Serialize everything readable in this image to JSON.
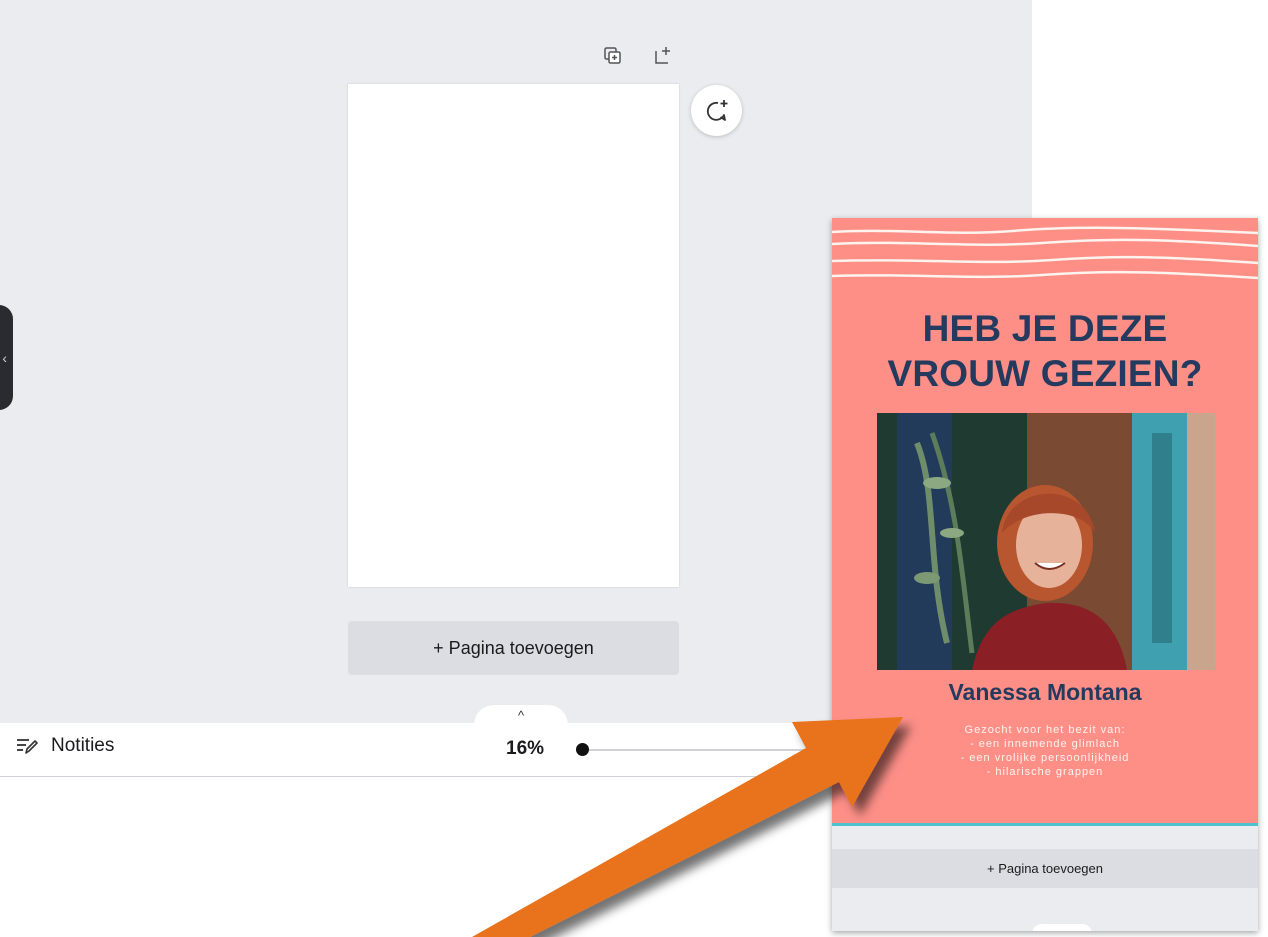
{
  "editor": {
    "add_page_label": "+ Pagina toevoegen",
    "side_handle_icon": "chevron-left-icon",
    "page_tools": [
      "duplicate-page-icon",
      "add-page-icon"
    ],
    "comment_icon": "add-comment-icon"
  },
  "footer": {
    "tab_icon": "^",
    "notes_label": "Notities",
    "zoom_label": "16%",
    "zoom_level_percent": 16
  },
  "preview": {
    "headline_line1": "HEB JE DEZE",
    "headline_line2": "VROUW GEZIEN?",
    "name": "Vanessa Montana",
    "details": [
      "Gezocht voor het bezit van:",
      "- een innemende glimlach",
      "- een vrolijke persoonlijkheid",
      "- hilarische grappen"
    ],
    "add_page_label": "+ Pagina toevoegen"
  },
  "colors": {
    "poster_background": "#fd8f87",
    "headline": "#243a5e",
    "arrow": "#e8731a",
    "canvas_background": "#ebecf0"
  }
}
